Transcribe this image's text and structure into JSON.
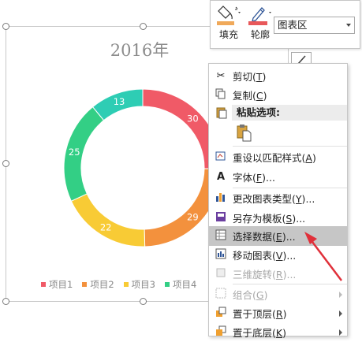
{
  "toolbar": {
    "fill_label": "填充",
    "outline_label": "轮廓",
    "element_select_value": "图表区",
    "fill_color": "#f0a95a",
    "outline_color": "#e8585a"
  },
  "chart": {
    "title": "2016年"
  },
  "chart_data": {
    "type": "pie",
    "title": "2016年",
    "categories": [
      "项目1",
      "项目2",
      "项目3",
      "项目4"
    ],
    "values": [
      30,
      29,
      22,
      25,
      13
    ],
    "series": [
      {
        "name": "项目1",
        "value": 30,
        "color": "#f05a67"
      },
      {
        "name": "项目2",
        "value": 29,
        "color": "#f3913d"
      },
      {
        "name": "项目3",
        "value": 22,
        "color": "#f8cb35"
      },
      {
        "name": "项目4",
        "value": 25,
        "color": "#33cf85"
      },
      {
        "name": "",
        "value": 13,
        "color": "#2ecdb4"
      }
    ],
    "donut": true,
    "legend_position": "bottom"
  },
  "legend": {
    "items": [
      {
        "label": "项目1",
        "color": "#f05a67"
      },
      {
        "label": "项目2",
        "color": "#f3913d"
      },
      {
        "label": "项目3",
        "color": "#f8cb35"
      },
      {
        "label": "项目4",
        "color": "#33cf85"
      }
    ]
  },
  "menu": {
    "cut": {
      "label": "剪切",
      "key": "T"
    },
    "copy": {
      "label": "复制",
      "key": "C"
    },
    "paste_options": "粘贴选项:",
    "reset_style": {
      "label": "重设以匹配样式",
      "key": "A"
    },
    "font": {
      "label": "字体",
      "key": "F",
      "suffix": "..."
    },
    "change_type": {
      "label": "更改图表类型",
      "key": "Y",
      "suffix": "..."
    },
    "save_template": {
      "label": "另存为模板",
      "key": "S",
      "suffix": "..."
    },
    "select_data": {
      "label": "选择数据",
      "key": "E",
      "suffix": "..."
    },
    "move_chart": {
      "label": "移动图表",
      "key": "V",
      "suffix": "..."
    },
    "rotate3d": {
      "label": "三维旋转",
      "key": "R",
      "suffix": "..."
    },
    "group": {
      "label": "组合",
      "key": "G"
    },
    "bring_front": {
      "label": "置于顶层",
      "key": "R"
    },
    "send_back": {
      "label": "置于底层",
      "key": "K"
    }
  },
  "annotation_color": "#e0303a"
}
